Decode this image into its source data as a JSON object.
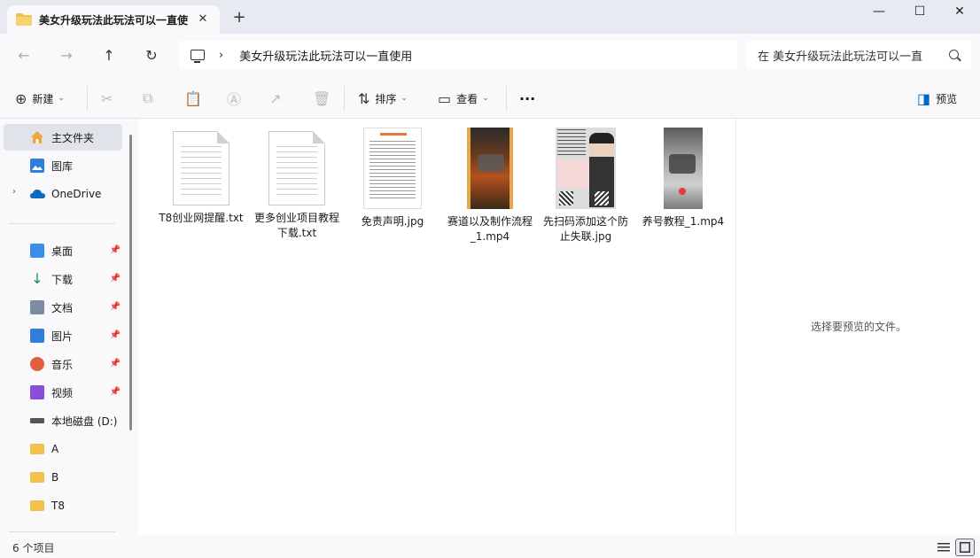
{
  "window": {
    "tab_title": "美女升级玩法此玩法可以一直使",
    "tab_close": "✕",
    "new_tab": "+",
    "minimize": "—",
    "maximize": "☐",
    "close": "✕"
  },
  "address": {
    "back": "←",
    "forward": "→",
    "up": "↑",
    "refresh": "↻",
    "chevron": "›",
    "path": "美女升级玩法此玩法可以一直使用",
    "search_placeholder": "在 美女升级玩法此玩法可以一直"
  },
  "toolbar": {
    "new_icon": "⊕",
    "new_label": "新建",
    "sort_icon": "⇅",
    "sort_label": "排序",
    "view_icon": "▭",
    "view_label": "查看",
    "more": "···",
    "preview_icon": "◨",
    "preview_label": "预览",
    "dropdown": "⌄"
  },
  "sidebar": {
    "home": "主文件夹",
    "gallery": "图库",
    "onedrive": "OneDrive",
    "expand": "›",
    "pin": "📌",
    "quick": [
      {
        "label": "桌面"
      },
      {
        "label": "下载"
      },
      {
        "label": "文档"
      },
      {
        "label": "图片"
      },
      {
        "label": "音乐"
      },
      {
        "label": "视频"
      }
    ],
    "drive": "本地磁盘 (D:)",
    "folders": [
      {
        "label": "A"
      },
      {
        "label": "B"
      },
      {
        "label": "T8"
      }
    ]
  },
  "files": [
    {
      "name": "T8创业网提醒.txt",
      "kind": "txt"
    },
    {
      "name": "更多创业项目教程下载.txt",
      "kind": "txt"
    },
    {
      "name": "免责声明.jpg",
      "kind": "jpg-doc"
    },
    {
      "name": "赛道以及制作流程_1.mp4",
      "kind": "video"
    },
    {
      "name": "先扫码添加这个防止失联.jpg",
      "kind": "jpg-photo"
    },
    {
      "name": "养号教程_1.mp4",
      "kind": "video"
    }
  ],
  "preview": {
    "message": "选择要预览的文件。"
  },
  "status": {
    "count": "6 个项目"
  },
  "colors": {
    "folder": "#f2c14a",
    "accent": "#0067c0"
  }
}
